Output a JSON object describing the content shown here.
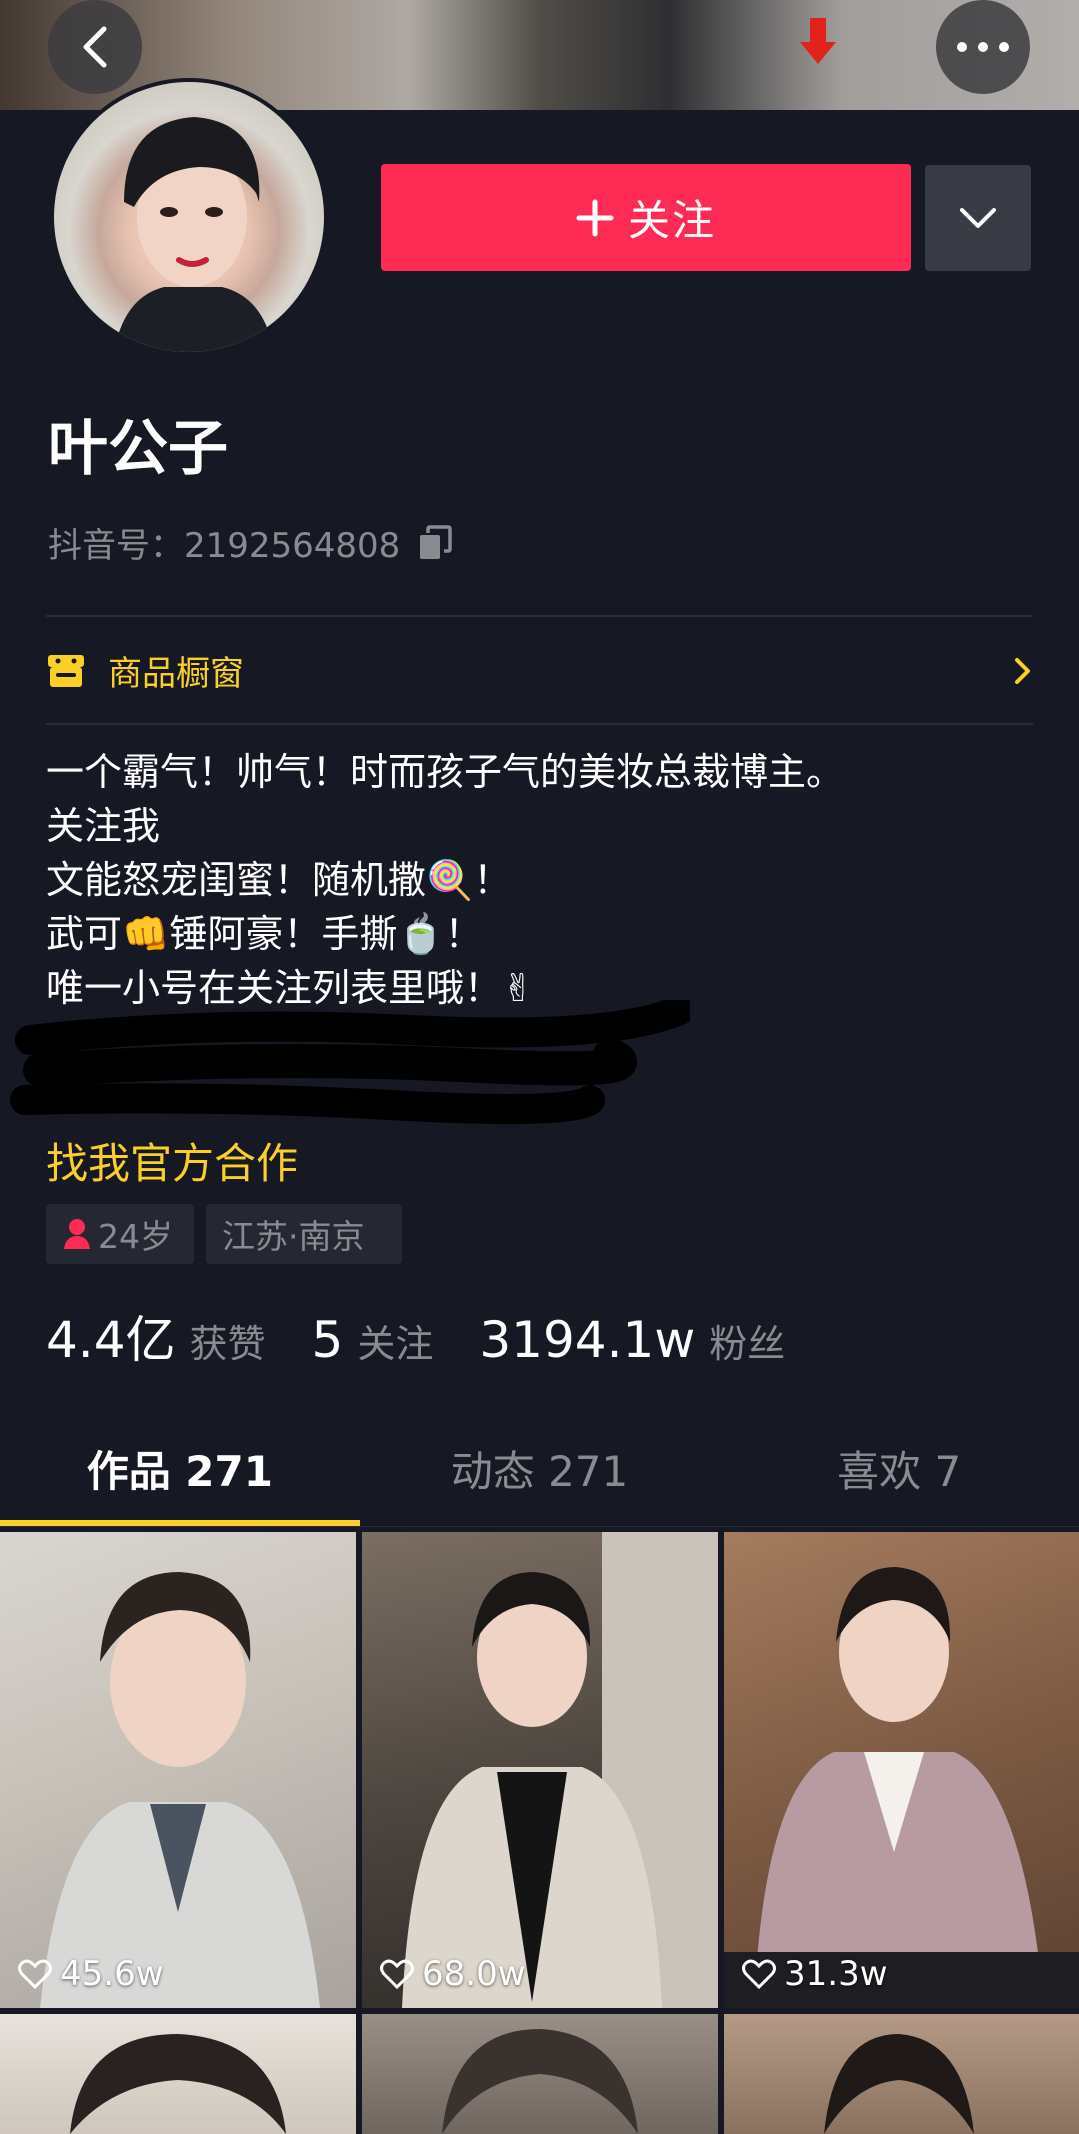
{
  "topbar": {
    "back_icon": "chevron-left-icon",
    "more_icon": "more-dots-icon"
  },
  "profile": {
    "name": "叶公子",
    "douyin_id": "抖音号：2192564808",
    "follow_label": "关注",
    "shop_label": "商品橱窗",
    "bio": [
      "一个霸气！帅气！时而孩子气的美妆总裁博主。",
      "关注我",
      "文能怒宠闺蜜！随机撒🍭！",
      "武可👊锤阿豪！手撕🍵！",
      "唯一小号在关注列表里哦！✌"
    ],
    "coop_link": "找我官方合作",
    "tags": {
      "age": "24岁",
      "location": "江苏·南京"
    }
  },
  "stats": [
    {
      "value": "4.4亿",
      "label": "获赞"
    },
    {
      "value": "5",
      "label": "关注"
    },
    {
      "value": "3194.1w",
      "label": "粉丝"
    }
  ],
  "tabs": [
    "作品 271",
    "动态 271",
    "喜欢 7"
  ],
  "videos": [
    {
      "likes": "45.6w"
    },
    {
      "likes": "68.0w"
    },
    {
      "likes": "31.3w"
    }
  ],
  "colors": {
    "background": "#161823",
    "accent": "#fe2c55",
    "highlight": "#facf27",
    "muted": "#8a8b91"
  }
}
